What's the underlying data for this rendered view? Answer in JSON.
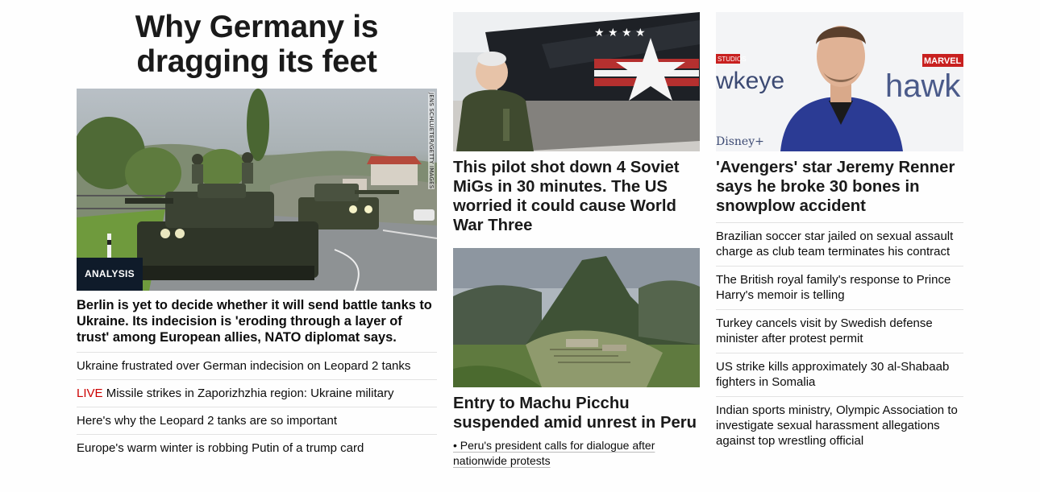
{
  "col1": {
    "headline": "Why Germany is dragging its feet",
    "image_credit": "JENS SCHLUETER/GETTY IMAGES",
    "badge": "ANALYSIS",
    "summary": "Berlin is yet to decide whether it will send battle tanks to Ukraine. Its indecision is 'eroding through a layer of trust' among European allies, NATO diplomat says.",
    "links": [
      {
        "prefix": "",
        "text": "Ukraine frustrated over German indecision on Leopard 2 tanks"
      },
      {
        "prefix": "LIVE",
        "text": " Missile strikes in Zaporizhzhia region: Ukraine military"
      },
      {
        "prefix": "",
        "text": "Here's why the Leopard 2 tanks are so important"
      },
      {
        "prefix": "",
        "text": "Europe's warm winter is robbing Putin of a trump card"
      }
    ]
  },
  "col2": {
    "story1": {
      "headline": "This pilot shot down 4 Soviet MiGs in 30 minutes. The US worried it could cause World War Three"
    },
    "story2": {
      "headline": "Entry to Machu Picchu suspended amid unrest in Peru",
      "sub_link": "• Peru's president calls for dialogue after nationwide protests"
    }
  },
  "col3": {
    "story": {
      "headline": "'Avengers' star Jeremy Renner says he broke 30 bones in snowplow accident"
    },
    "image_text": {
      "left": "wkeye",
      "right": "hawk",
      "brand": "MARVEL STUD",
      "brand_small": "STUDIOS",
      "disney": "Disney+"
    },
    "links": [
      "Brazilian soccer star jailed on sexual assault charge as club team terminates his contract",
      "The British royal family's response to Prince Harry's memoir is telling",
      "Turkey cancels visit by Swedish defense minister after protest permit",
      "US strike kills approximately 30 al-Shabaab fighters in Somalia",
      "Indian sports ministry, Olympic Association to investigate sexual harassment allegations against top wrestling official"
    ]
  },
  "colors": {
    "live": "#cc0000",
    "badge_bg": "#0f1b2a",
    "text": "#0c0c0c",
    "divider": "#e2e2e2"
  }
}
